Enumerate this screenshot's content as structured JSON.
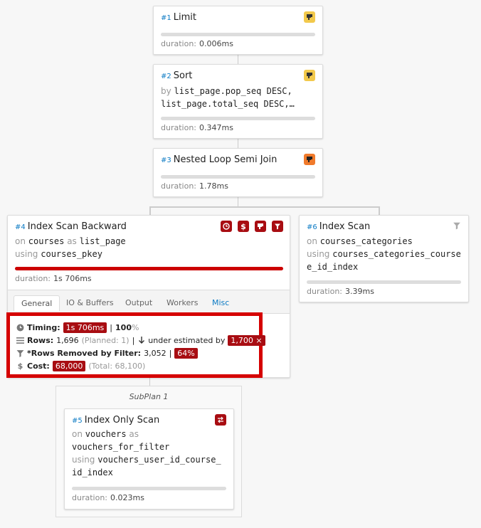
{
  "nodes": {
    "limit": {
      "num": "#1",
      "title": "Limit",
      "duration_label": "duration:",
      "duration": "0.006ms"
    },
    "sort": {
      "num": "#2",
      "title": "Sort",
      "kw_by": "by",
      "line1": "list_page.pop_seq DESC,",
      "line2": "list_page.total_seq DESC,…",
      "duration_label": "duration:",
      "duration": "0.347ms"
    },
    "nested": {
      "num": "#3",
      "title": "Nested Loop Semi Join",
      "duration_label": "duration:",
      "duration": "1.78ms"
    },
    "isb": {
      "num": "#4",
      "title": "Index Scan Backward",
      "kw_on": "on",
      "rel": "courses",
      "kw_as": "as",
      "alias": "list_page",
      "kw_using": "using",
      "index": "courses_pkey",
      "duration_label": "duration:",
      "duration": "1s 706ms",
      "tabs": [
        "General",
        "IO & Buffers",
        "Output",
        "Workers",
        "Misc"
      ]
    },
    "is6": {
      "num": "#6",
      "title": "Index Scan",
      "kw_on": "on",
      "rel": "courses_categories",
      "kw_using": "using",
      "index1": "courses_categories_course",
      "index2": "e_id_index",
      "duration_label": "duration:",
      "duration": "3.39ms"
    },
    "ios": {
      "num": "#5",
      "title": "Index Only Scan",
      "kw_on": "on",
      "rel": "vouchers",
      "kw_as": "as",
      "alias": "vouchers_for_filter",
      "kw_using": "using",
      "index1": "vouchers_user_id_course_",
      "index2": "id_index",
      "duration_label": "duration:",
      "duration": "0.023ms"
    }
  },
  "details": {
    "timing_label": "Timing:",
    "timing": "1s 706ms",
    "timing_sep": "|",
    "timing_pct": "100",
    "timing_pct_sign": "%",
    "rows_label": "Rows:",
    "rows": "1,696",
    "planned": "(Planned: 1)",
    "rows_sep": "|",
    "estimate_text": "under estimated by",
    "estimate_badge": "1,700 ×",
    "filter_label": "*Rows Removed by Filter:",
    "filter_rows": "3,052",
    "filter_sep": "|",
    "filter_pct": "64%",
    "cost_label": "Cost:",
    "cost": "68,000",
    "total": "(Total: 68,100)"
  },
  "subplan": {
    "label": "SubPlan 1"
  },
  "colors": {
    "accent": "#0d7bc4",
    "danger": "#a80d12",
    "highlight": "#d50000",
    "warning_yellow": "#f2c94c",
    "warning_orange": "#f07a2b"
  }
}
